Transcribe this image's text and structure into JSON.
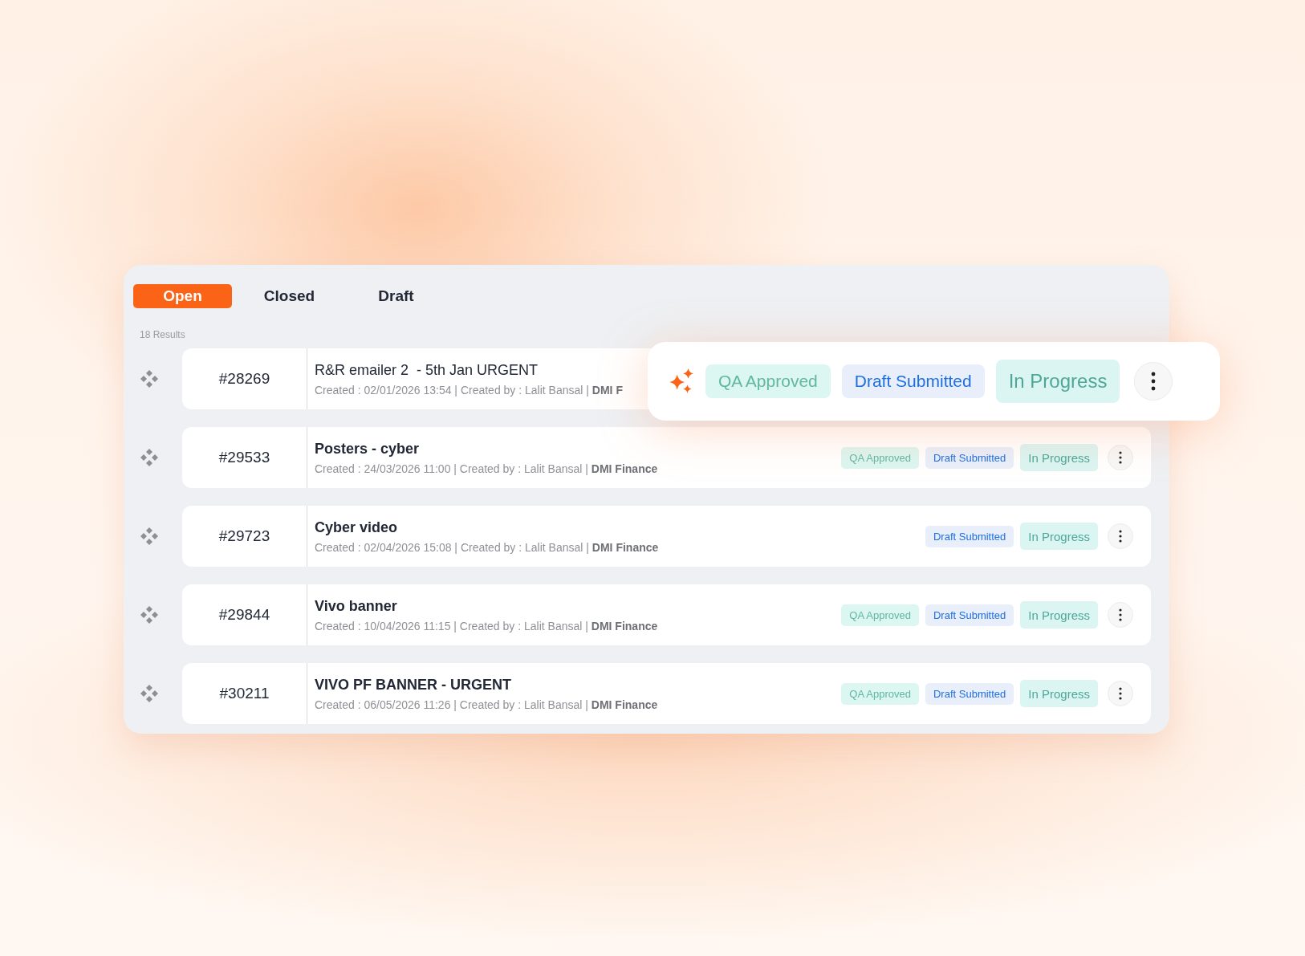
{
  "tabs": [
    {
      "label": "Open",
      "selected": true
    },
    {
      "label": "Closed",
      "selected": false
    },
    {
      "label": "Draft",
      "selected": false
    }
  ],
  "results": "18 Results",
  "rows": [
    {
      "id": "#28269",
      "title": "R&R emailer 2  - 5th Jan URGENT",
      "title_bold": false,
      "meta": "Created : 02/01/2026 13:54 | Created by : Lalit Bansal | **DMI F**"
    },
    {
      "id": "#29533",
      "title": "Posters - cyber",
      "title_bold": true,
      "meta": "Created : 24/03/2026 11:00 | Created by : Lalit Bansal | **DMI Finance**",
      "badges": [
        {
          "kind": "qa",
          "label": "QA Approved"
        },
        {
          "kind": "draft",
          "label": "Draft Submitted"
        },
        {
          "kind": "progress",
          "label": "In Progress"
        }
      ]
    },
    {
      "id": "#29723",
      "title": "Cyber video",
      "title_bold": true,
      "meta": "Created : 02/04/2026 15:08 | Created by : Lalit Bansal | **DMI Finance**",
      "badges": [
        {
          "kind": "draft",
          "label": "Draft Submitted"
        },
        {
          "kind": "progress",
          "label": "In Progress"
        }
      ]
    },
    {
      "id": "#29844",
      "title": "Vivo banner",
      "title_bold": true,
      "meta": "Created : 10/04/2026 11:15 | Created by : Lalit Bansal | **DMI Finance**",
      "badges": [
        {
          "kind": "qa",
          "label": "QA Approved"
        },
        {
          "kind": "draft",
          "label": "Draft Submitted"
        },
        {
          "kind": "progress",
          "label": "In Progress"
        }
      ]
    },
    {
      "id": "#30211",
      "title": "VIVO PF BANNER - URGENT",
      "title_bold": true,
      "meta": "Created : 06/05/2026 11:26 | Created by : Lalit Bansal | **DMI Finance**",
      "badges": [
        {
          "kind": "qa",
          "label": "QA Approved"
        },
        {
          "kind": "draft",
          "label": "Draft Submitted"
        },
        {
          "kind": "progress",
          "label": "In Progress"
        }
      ]
    }
  ],
  "popup": {
    "badges": [
      {
        "kind": "qa",
        "label": "QA Approved"
      },
      {
        "kind": "draft",
        "label": "Draft Submitted"
      },
      {
        "kind": "progress",
        "label": "In Progress"
      }
    ]
  }
}
